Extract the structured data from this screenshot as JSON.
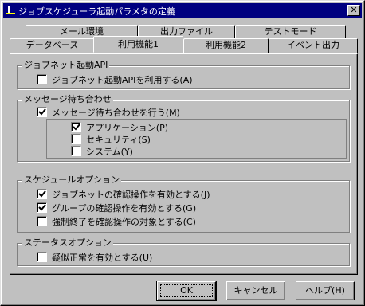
{
  "window": {
    "title": "ジョブスケジューラ起動パラメタの定義",
    "close_glyph": "✕"
  },
  "tabs_back": [
    {
      "label": "メール環境"
    },
    {
      "label": "出力ファイル"
    },
    {
      "label": "テストモード"
    }
  ],
  "tabs_front": [
    {
      "label": "データベース"
    },
    {
      "label": "利用機能1",
      "active": true
    },
    {
      "label": "利用機能2"
    },
    {
      "label": "イベント出力"
    }
  ],
  "groups": {
    "jobnet": {
      "title": "ジョブネット起動API",
      "items": [
        {
          "label": "ジョブネット起動APIを利用する(A)",
          "checked": false
        }
      ]
    },
    "message": {
      "title": "メッセージ待ち合わせ",
      "items": [
        {
          "label": "メッセージ待ち合わせを行う(M)",
          "checked": true
        },
        {
          "label": "アプリケーション(P)",
          "checked": true
        },
        {
          "label": "セキュリティ(S)",
          "checked": false
        },
        {
          "label": "システム(Y)",
          "checked": false
        }
      ]
    },
    "schedule": {
      "title": "スケジュールオプション",
      "items": [
        {
          "label": "ジョブネットの確認操作を有効とする(J)",
          "checked": true
        },
        {
          "label": "グループの確認操作を有効とする(G)",
          "checked": true
        },
        {
          "label": "強制終了を確認操作の対象とする(C)",
          "checked": false
        }
      ]
    },
    "status": {
      "title": "ステータスオプション",
      "items": [
        {
          "label": "疑似正常を有効とする(U)",
          "checked": false
        }
      ]
    }
  },
  "buttons": {
    "ok": "OK",
    "cancel": "キャンセル",
    "help": "ヘルプ(H)"
  }
}
